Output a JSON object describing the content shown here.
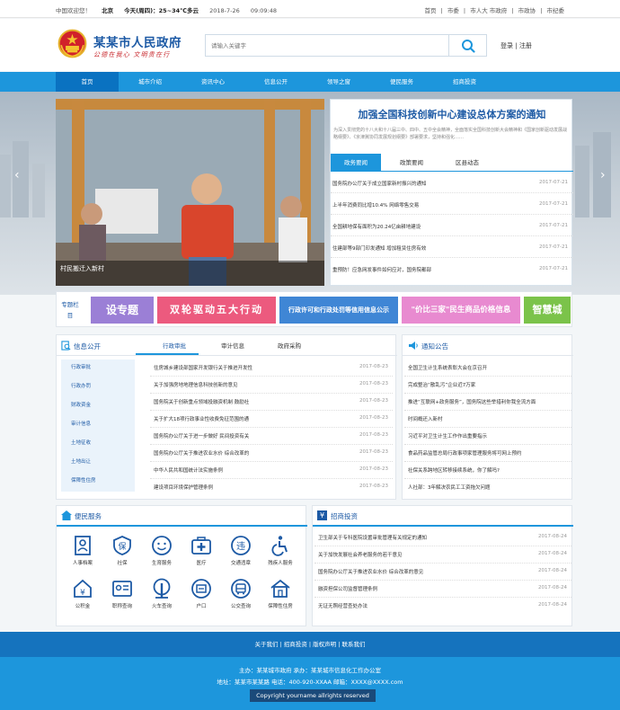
{
  "topbar": {
    "welcome": "中国欢迎您！",
    "city": "北京",
    "weather": "今天(周四)：25~34℃多云",
    "date": "2018-7-26",
    "time": "09:09:48",
    "links": [
      "首页",
      "|",
      "市委",
      "|",
      "市人大 市政府",
      "|",
      "市政协",
      "|",
      "市纪委"
    ]
  },
  "header": {
    "title": "某某市人民政府",
    "slogan": "公德在我心  文明贵在行",
    "search_placeholder": "请输入关键字",
    "login": "登录",
    "sep": "|",
    "register": "注册"
  },
  "nav": {
    "items": [
      "首页",
      "城市介绍",
      "资讯中心",
      "信息公开",
      "领导之窗",
      "便民服务",
      "招商投资"
    ]
  },
  "slider": {
    "caption": "村民搬迁入新村",
    "dots": [
      "1",
      "2",
      "3",
      "4"
    ],
    "active_dot": 1
  },
  "headline": {
    "title": "加强全国科技创新中心建设总体方案的通知",
    "desc": "为深入贯彻党的十八大和十八届三中、四中、五中全会精神，全面落实全国科技创新大会精神和《国家创新驱动发展战略纲要》、《京津冀协同发展规划纲要》部署要求，坚持和强化……",
    "tabs": [
      "政务要闻",
      "政策要闻",
      "区县动态"
    ],
    "news": [
      {
        "title": "国务院办公厅关于成立国家新村振兴的通知",
        "date": "2017-07-21"
      },
      {
        "title": "上半年消费同比增10.4% 网络零售交易",
        "date": "2017-07-21"
      },
      {
        "title": "全国耕地保有面积为20.24亿亩耕地建设",
        "date": "2017-07-21"
      },
      {
        "title": "住建部等9部门印发通知 增加租赁住房有效",
        "date": "2017-07-21"
      },
      {
        "title": "重预防！应急网发事件如何应对，国务院都部",
        "date": "2017-07-21"
      }
    ]
  },
  "topics": {
    "label": "专题栏目",
    "banners": [
      "设专题",
      "双轮驱动五大行动",
      "行政许可和行政处罚等信用信息公示",
      "\"价比三家\"民生商品价格信息",
      "智慧城"
    ]
  },
  "info": {
    "title": "信息公开",
    "tabs": [
      "行政审批",
      "审计信息",
      "政府采购"
    ],
    "sidebar": [
      "行政审批",
      "行政办罚",
      "财政资金",
      "审计信息",
      "土地征收",
      "土地出让",
      "保障性住房"
    ],
    "rows": [
      {
        "title": "住房城乡建设部国家开发银行关于推进开发性",
        "date": "2017-08-23"
      },
      {
        "title": "关于加强房地地理信息科技创新的意见",
        "date": "2017-08-23"
      },
      {
        "title": "国务院关于创新重点领域投融资机制 鼓励社",
        "date": "2017-08-23"
      },
      {
        "title": "关于扩大18项行政事业性收费免征范围的通",
        "date": "2017-08-23"
      },
      {
        "title": "国务院办公厅关于进一步做好 民间投资有关",
        "date": "2017-08-23"
      },
      {
        "title": "国务院办公厅关于推进农业水价 综合改革的",
        "date": "2017-08-23"
      },
      {
        "title": "中华人民共和国统计法实施条例",
        "date": "2017-08-23"
      },
      {
        "title": "建设项目环境保护管理条例",
        "date": "2017-08-23"
      }
    ]
  },
  "notice": {
    "title": "通知公告",
    "rows": [
      "全国卫生计生系统表彰大会在京召开",
      "完成整治“散乱污”企业近7万家",
      "推进“互联网+政务服务”，国务院这些举措利你我全流方面",
      "时间概还入新村",
      "习近平对卫生计生工作作出重要指示",
      "食品药品监管总局行政事项家管理服务将可网上预约",
      "社保关系跨地区转移接续系统，你了解吗?",
      "人社部：3年解决农民工工资拖欠问题"
    ]
  },
  "service": {
    "title": "便民服务",
    "items": [
      {
        "label": "人事档案",
        "icon": "personnel-file-icon"
      },
      {
        "label": "社保",
        "icon": "social-security-icon"
      },
      {
        "label": "生育服务",
        "icon": "maternity-icon"
      },
      {
        "label": "医疗",
        "icon": "medical-icon"
      },
      {
        "label": "交通违章",
        "icon": "traffic-violation-icon"
      },
      {
        "label": "残疾人服务",
        "icon": "disability-icon"
      },
      {
        "label": "公积金",
        "icon": "housing-fund-icon"
      },
      {
        "label": "职称查询",
        "icon": "title-query-icon"
      },
      {
        "label": "火车查询",
        "icon": "train-icon"
      },
      {
        "label": "户口",
        "icon": "household-icon"
      },
      {
        "label": "公交查询",
        "icon": "bus-icon"
      },
      {
        "label": "保障性住房",
        "icon": "housing-icon"
      }
    ]
  },
  "invest": {
    "title": "招商投资",
    "rows": [
      {
        "title": "卫生部关于专科医院设置审批管理有关规定的通知",
        "date": "2017-08-24"
      },
      {
        "title": "关于加快发展社会养老服务的若干意见",
        "date": "2017-08-24"
      },
      {
        "title": "国务院办公厅关于推进农业水价 综合改革的意见",
        "date": "2017-08-24"
      },
      {
        "title": "融资担保公司监督管理条例",
        "date": "2017-08-24"
      },
      {
        "title": "无证无照经营查处办法",
        "date": "2017-08-24"
      }
    ]
  },
  "footer": {
    "links": "关于我们 | 招商投资 | 版权声明 | 联系我们",
    "sponsor": "主办：某某城市政府    承办：某某城市信息化工作办公室",
    "address": "地址：某某市某某路    电话：400-920-XXAA    邮箱：XXXX@XXXX.com",
    "copyright": "Copyright yourname allrights reserved"
  },
  "colors": {
    "primary": "#1d96dc",
    "dark": "#1573be",
    "title": "#1d5aa5",
    "accent": "#c8282d"
  }
}
